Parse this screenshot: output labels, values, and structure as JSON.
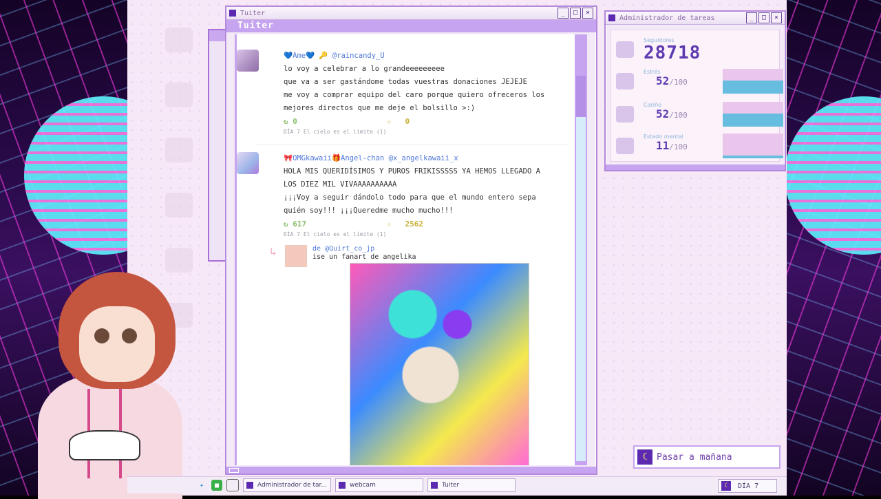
{
  "tuiter": {
    "window_title": "Tuiter",
    "app_title": "Tuiter",
    "posts": [
      {
        "author": "💙Ame💙 🔑 @raincandy_U",
        "lines": [
          "lo voy a celebrar a lo grandeeeeeeeee",
          "que va a ser gastándome todas vuestras donaciones JEJEJE",
          "me voy a comprar equipo del caro porque quiero ofreceros los",
          "mejores directos que me deje el bolsillo >:)"
        ],
        "retweets": "0",
        "favorites": "0",
        "meta": "DÍA 7 El cielo es el límite (1)"
      },
      {
        "author": "🎀OMGkawaii🎁Angel-chan @x_angelkawaii_x",
        "lines": [
          "HOLA MIS QUERIDÍSIMOS Y PUROS FRIKISSSSS YA HEMOS LLEGADO A",
          "LOS DIEZ MIL VIVAAAAAAAAAA",
          " ¡¡¡Voy a seguir dándolo todo para que el mundo entero sepa",
          "quién soy!!! ¡¡¡Queredme mucho mucho!!!"
        ],
        "retweets": "617",
        "favorites": "2562",
        "meta": "DÍA 7 El cielo es el límite (1)"
      }
    ],
    "quote": {
      "from": "de @Quirt_co_jp",
      "text": "ise un fanart de angelika"
    }
  },
  "task_manager": {
    "title": "Administrador de tareas",
    "followers_label": "Seguidores",
    "followers": "28718",
    "stats": [
      {
        "label": "Estrés",
        "value": "52",
        "max": "/100",
        "level": 0.52
      },
      {
        "label": "Cariño",
        "value": "52",
        "max": "/100",
        "level": 0.52
      },
      {
        "label": "Estado mental",
        "value": "11",
        "max": "/100",
        "level": 0.11
      }
    ]
  },
  "pass_button": "Pasar a mañana",
  "taskbar": {
    "tasks": [
      "Administrador de tar...",
      "webcam",
      "Tuiter"
    ],
    "day": "DÍA 7"
  },
  "colors": {
    "accent": "#c6a4ef",
    "dark_accent": "#5b2ab0",
    "stat_fill": "#66bde0",
    "stat_bg": "#eac6ec"
  }
}
